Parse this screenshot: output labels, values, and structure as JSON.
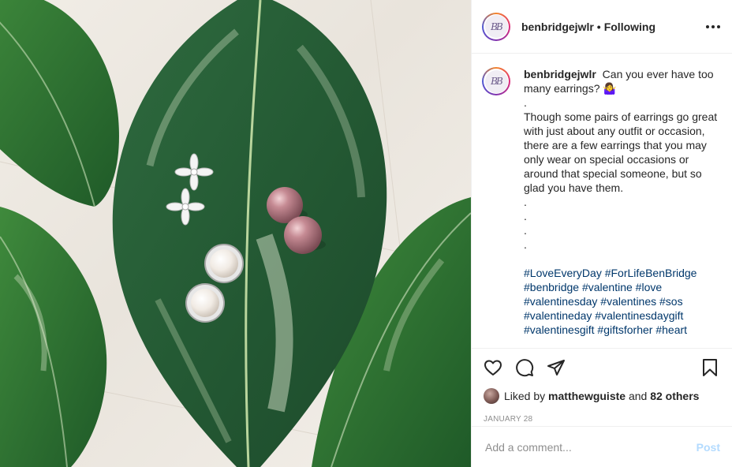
{
  "post": {
    "username": "benbridgejwlr",
    "separator": "•",
    "follow_status": "Following",
    "avatar_initials": "BB",
    "more_icon": "more-horizontal-icon"
  },
  "caption": {
    "username": "benbridgejwlr",
    "text_lines": [
      "Can you ever have too many earrings? 🤷‍♀️",
      ".",
      "Though some pairs of earrings go great with just about any outfit or occasion, there are a few earrings that you may only wear on special occasions or around that special someone, but so glad you have them.",
      ".",
      ".",
      ".",
      "."
    ],
    "hashtags": [
      "#LoveEveryDay",
      "#ForLifeBenBridge",
      "#benbridge",
      "#valentine",
      "#love",
      "#valentinesday",
      "#valentines",
      "#sos",
      "#valentineday",
      "#valentinesdaygift",
      "#valentinesgift",
      "#giftsforher",
      "#heart"
    ]
  },
  "actions": {
    "icons": [
      "heart-icon",
      "comment-icon",
      "share-icon",
      "bookmark-icon"
    ]
  },
  "likes": {
    "prefix": "Liked by",
    "liker": "matthewguiste",
    "joiner": "and",
    "others": "82 others"
  },
  "date": "JANUARY 28",
  "comment_box": {
    "placeholder": "Add a comment...",
    "post_label": "Post",
    "post_color": "#b3dbff"
  },
  "colors": {
    "link": "#00376b",
    "border": "#efefef",
    "muted": "#8e8e8e"
  }
}
